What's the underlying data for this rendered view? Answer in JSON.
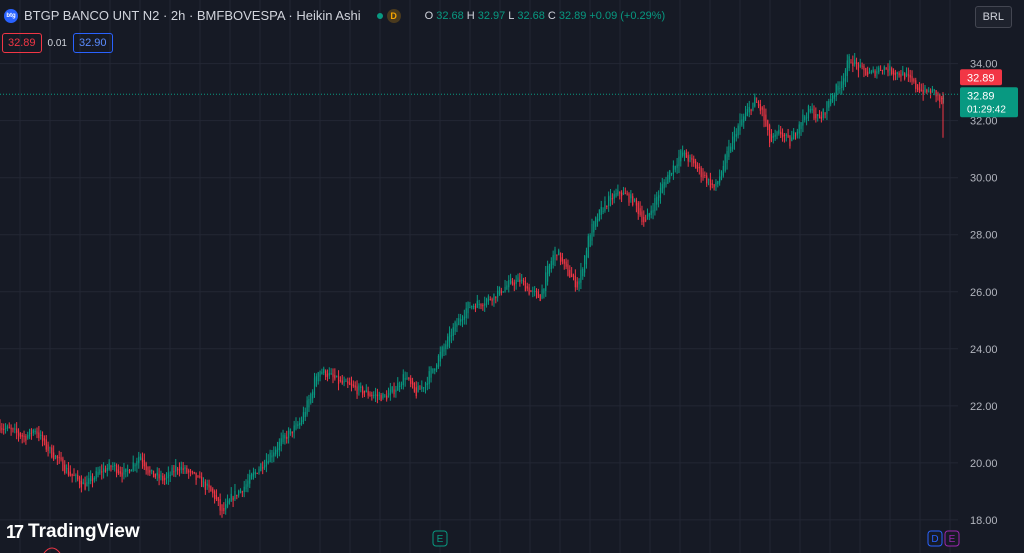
{
  "header": {
    "symbol_title": "BTGP BANCO UNT N2 · 2h · BMFBOVESPA · Heikin Ashi",
    "badge_d": "D",
    "ohlc": {
      "o_label": "O",
      "o_value": "32.68",
      "h_label": "H",
      "h_value": "32.97",
      "l_label": "L",
      "l_value": "32.68",
      "c_label": "C",
      "c_value": "32.89",
      "change": "+0.09 (+0.29%)"
    }
  },
  "trade": {
    "sell_price": "32.89",
    "spread": "0.01",
    "buy_price": "32.90"
  },
  "currency_button": "BRL",
  "branding": {
    "logo_text": "TradingView"
  },
  "events": {
    "earnings_label": "E",
    "dividend_label": "D"
  },
  "colors": {
    "up": "#089981",
    "down": "#f23645",
    "background": "#161a25",
    "grid": "#232734"
  },
  "chart_data": {
    "type": "candlestick",
    "style": "Heikin Ashi",
    "y_ticks": [
      "18.00",
      "20.00",
      "22.00",
      "24.00",
      "26.00",
      "28.00",
      "30.00",
      "32.00",
      "34.00"
    ],
    "ylim": [
      17.4,
      35.6
    ],
    "last_price_label": "32.89",
    "last_price_countdown": "01:29:42",
    "upper_price_label": "32.89",
    "anchors": [
      [
        0,
        21.3
      ],
      [
        12,
        21.1
      ],
      [
        25,
        20.9
      ],
      [
        35,
        21.2
      ],
      [
        45,
        20.6
      ],
      [
        58,
        20.1
      ],
      [
        70,
        19.6
      ],
      [
        85,
        19.2
      ],
      [
        100,
        19.7
      ],
      [
        112,
        19.9
      ],
      [
        125,
        19.6
      ],
      [
        140,
        20.3
      ],
      [
        150,
        19.6
      ],
      [
        165,
        19.4
      ],
      [
        178,
        19.9
      ],
      [
        190,
        19.6
      ],
      [
        205,
        19.2
      ],
      [
        215,
        18.8
      ],
      [
        222,
        18.2
      ],
      [
        232,
        18.8
      ],
      [
        245,
        19.2
      ],
      [
        258,
        19.8
      ],
      [
        270,
        20.3
      ],
      [
        285,
        20.9
      ],
      [
        300,
        21.4
      ],
      [
        310,
        22.3
      ],
      [
        318,
        23.3
      ],
      [
        328,
        23.1
      ],
      [
        340,
        22.8
      ],
      [
        355,
        22.6
      ],
      [
        370,
        22.4
      ],
      [
        385,
        22.3
      ],
      [
        395,
        22.6
      ],
      [
        405,
        23.1
      ],
      [
        415,
        22.4
      ],
      [
        425,
        22.8
      ],
      [
        440,
        23.8
      ],
      [
        455,
        24.8
      ],
      [
        468,
        25.5
      ],
      [
        480,
        25.6
      ],
      [
        495,
        25.9
      ],
      [
        510,
        26.3
      ],
      [
        520,
        26.4
      ],
      [
        530,
        26.0
      ],
      [
        540,
        25.8
      ],
      [
        548,
        26.8
      ],
      [
        556,
        27.5
      ],
      [
        565,
        26.8
      ],
      [
        578,
        26.2
      ],
      [
        590,
        28.1
      ],
      [
        605,
        29.1
      ],
      [
        620,
        29.5
      ],
      [
        633,
        29.2
      ],
      [
        645,
        28.4
      ],
      [
        655,
        29.2
      ],
      [
        668,
        30.1
      ],
      [
        682,
        30.9
      ],
      [
        695,
        30.4
      ],
      [
        705,
        30.0
      ],
      [
        715,
        29.6
      ],
      [
        725,
        30.6
      ],
      [
        735,
        31.6
      ],
      [
        745,
        32.2
      ],
      [
        755,
        32.7
      ],
      [
        762,
        32.3
      ],
      [
        770,
        31.2
      ],
      [
        780,
        31.6
      ],
      [
        790,
        31.2
      ],
      [
        800,
        32.0
      ],
      [
        810,
        32.4
      ],
      [
        820,
        32.0
      ],
      [
        830,
        32.8
      ],
      [
        840,
        33.3
      ],
      [
        850,
        34.2
      ],
      [
        860,
        33.8
      ],
      [
        870,
        33.6
      ],
      [
        882,
        33.9
      ],
      [
        895,
        33.7
      ],
      [
        905,
        33.6
      ],
      [
        915,
        33.2
      ],
      [
        925,
        33.0
      ],
      [
        935,
        33.0
      ],
      [
        941,
        32.6
      ],
      [
        945,
        32.89
      ]
    ]
  }
}
